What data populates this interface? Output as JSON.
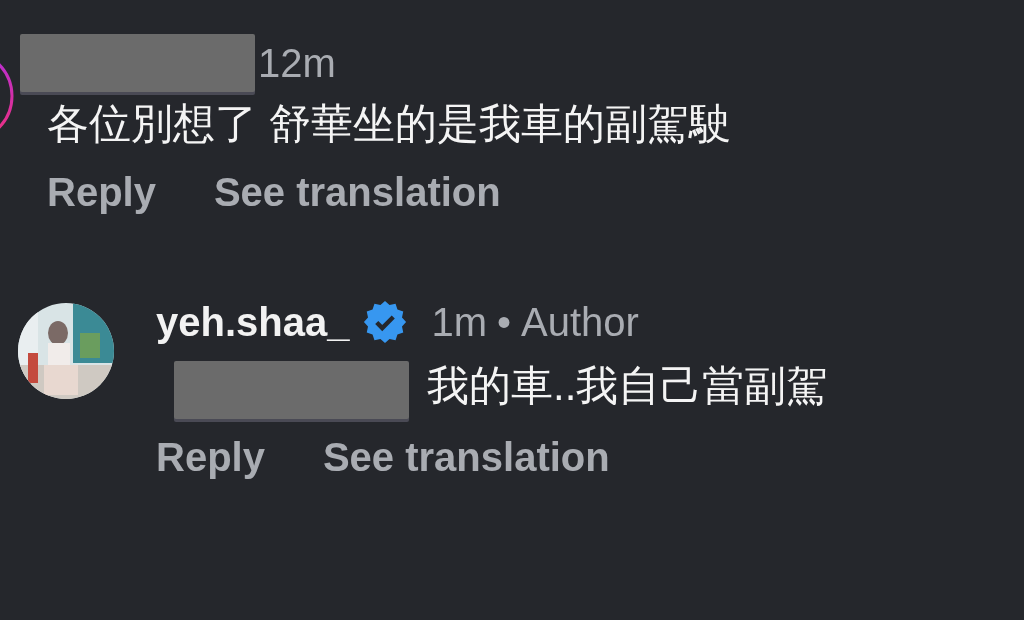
{
  "comments": [
    {
      "avatar": {
        "kind": "story_ring"
      },
      "author_redacted": true,
      "time": "12m",
      "text": "各位別想了 舒華坐的是我車的副駕駛",
      "actions": [
        "Reply",
        "See translation"
      ]
    },
    {
      "author": "yeh.shaa_",
      "verified": true,
      "time": "1m",
      "separator": "•",
      "role": "Author",
      "mention_redacted": true,
      "text": "我的車..我自己當副駕",
      "actions": [
        "Reply",
        "See translation"
      ]
    }
  ]
}
